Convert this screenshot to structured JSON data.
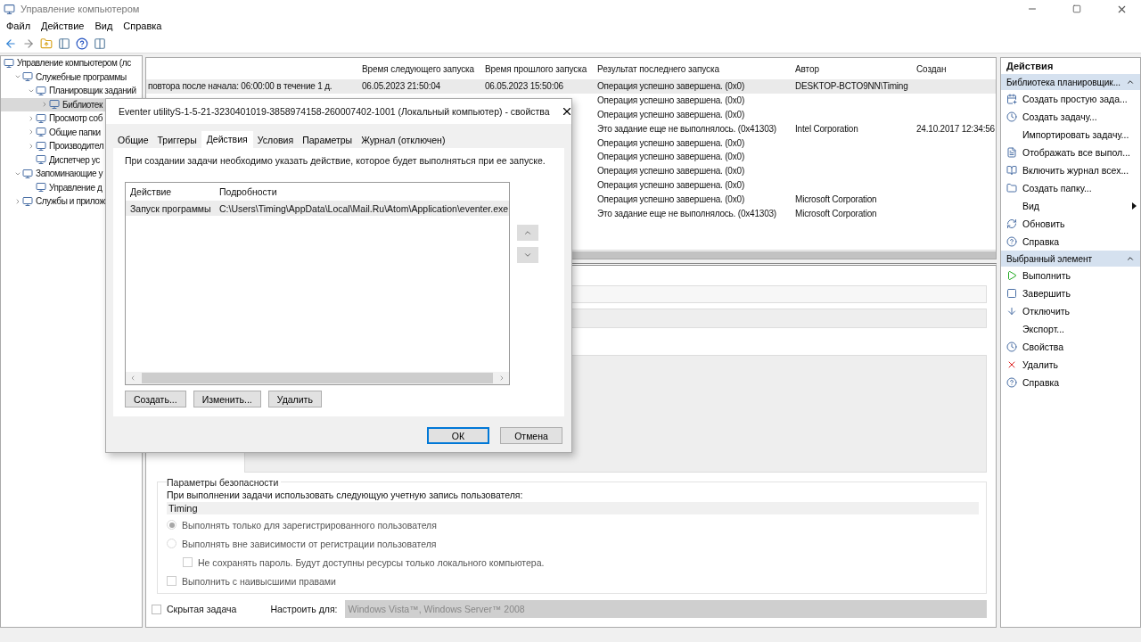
{
  "window": {
    "title": "Управление компьютером"
  },
  "menu": [
    "Файл",
    "Действие",
    "Вид",
    "Справка"
  ],
  "tree": [
    {
      "label": "Управление компьютером (лс",
      "selected": false,
      "children": [
        {
          "label": "Служебные программы",
          "expanded": true,
          "selected": false,
          "children": [
            {
              "label": "Планировщик заданий",
              "expanded": true,
              "selected": false,
              "children": [
                {
                  "label": "Библиотек",
                  "expanded": false,
                  "selected": true
                }
              ]
            },
            {
              "label": "Просмотр соб",
              "expanded": false,
              "selected": false
            },
            {
              "label": "Общие папки",
              "expanded": false,
              "selected": false
            },
            {
              "label": "Производител",
              "expanded": false,
              "selected": false
            },
            {
              "label": "Диспетчер ус",
              "selected": false
            }
          ]
        },
        {
          "label": "Запоминающие у",
          "expanded": true,
          "selected": false,
          "children": [
            {
              "label": "Управление д",
              "selected": false
            }
          ]
        },
        {
          "label": "Службы и прилож",
          "expanded": false,
          "selected": false
        }
      ]
    }
  ],
  "table": {
    "columns": [
      "",
      "Время следующего запуска",
      "Время прошлого запуска",
      "Результат последнего запуска",
      "Автор",
      "Создан"
    ],
    "rows": [
      {
        "selected": true,
        "cells": [
          "повтора после начала: 06:00:00 в течение 1 д.",
          "06.05.2023 21:50:04",
          "06.05.2023 15:50:06",
          "Операция успешно завершена. (0x0)",
          "DESKTOP-BCTO9NN\\Timing",
          ""
        ]
      },
      {
        "selected": false,
        "cells": [
          "",
          "",
          "",
          "Операция успешно завершена. (0x0)",
          "",
          ""
        ]
      },
      {
        "selected": false,
        "cells": [
          "",
          "",
          "",
          "Операция успешно завершена. (0x0)",
          "",
          ""
        ]
      },
      {
        "selected": false,
        "cells": [
          "",
          "",
          "",
          "Это задание еще не выполнялось. (0x41303)",
          "Intel Corporation",
          "24.10.2017 12:34:56"
        ]
      },
      {
        "selected": false,
        "cells": [
          "",
          "",
          "",
          "Операция успешно завершена. (0x0)",
          "",
          ""
        ]
      },
      {
        "selected": false,
        "cells": [
          "",
          "",
          "",
          "Операция успешно завершена. (0x0)",
          "",
          ""
        ]
      },
      {
        "selected": false,
        "cells": [
          "",
          "",
          "",
          "Операция успешно завершена. (0x0)",
          "",
          ""
        ]
      },
      {
        "selected": false,
        "cells": [
          "",
          "",
          "",
          "Операция успешно завершена. (0x0)",
          "",
          ""
        ]
      },
      {
        "selected": false,
        "cells": [
          "",
          "",
          "",
          "Операция успешно завершена. (0x0)",
          "Microsoft Corporation",
          ""
        ]
      },
      {
        "selected": false,
        "cells": [
          "",
          "",
          "",
          "Это задание еще не выполнялось. (0x41303)",
          "Microsoft Corporation",
          ""
        ]
      }
    ]
  },
  "security": {
    "title": "Параметры безопасности",
    "account_label": "При выполнении задачи использовать следующую учетную запись пользователя:",
    "account": "Timing",
    "options": [
      {
        "kind": "radio",
        "label": "Выполнять только для зарегистрированного пользователя",
        "selected": true,
        "disabled": true
      },
      {
        "kind": "radio",
        "label": "Выполнять вне зависимости от регистрации пользователя",
        "selected": false,
        "disabled": true
      },
      {
        "kind": "subcheck",
        "label": "Не сохранять пароль. Будут доступны ресурсы только локального компьютера.",
        "checked": false,
        "disabled": true
      },
      {
        "kind": "check",
        "label": "Выполнить с наивысшими правами",
        "checked": false,
        "disabled": true
      }
    ],
    "hidden": {
      "label": "Скрытая задача",
      "checked": false
    },
    "configure": {
      "label": "Настроить для:",
      "value": "Windows Vista™, Windows Server™ 2008"
    }
  },
  "actions": {
    "title": "Действия",
    "sections": [
      {
        "title": "Библиотека планировщик...",
        "expanded": true,
        "items": [
          {
            "label": "Создать простую зада..."
          },
          {
            "label": "Создать задачу..."
          },
          {
            "label": "Импортировать задачу..."
          },
          {
            "label": "Отображать все выпол..."
          },
          {
            "label": "Включить журнал всех..."
          },
          {
            "label": "Создать папку..."
          },
          {
            "label": "Вид",
            "kind": "submenu"
          },
          {
            "label": "Обновить"
          },
          {
            "label": "Справка"
          }
        ]
      },
      {
        "title": "Выбранный элемент",
        "expanded": true,
        "items": [
          {
            "label": "Выполнить"
          },
          {
            "label": "Завершить"
          },
          {
            "label": "Отключить"
          },
          {
            "label": "Экспорт..."
          },
          {
            "label": "Свойства"
          },
          {
            "label": "Удалить"
          },
          {
            "label": "Справка"
          }
        ]
      }
    ]
  },
  "dialog": {
    "title": "Eventer utilityS-1-5-21-3230401019-3858974158-260007402-1001 (Локальный компьютер) - свойства",
    "tabs": [
      {
        "label": "Общие",
        "selected": false
      },
      {
        "label": "Триггеры",
        "selected": false
      },
      {
        "label": "Действия",
        "selected": true
      },
      {
        "label": "Условия",
        "selected": false
      },
      {
        "label": "Параметры",
        "selected": false
      },
      {
        "label": "Журнал (отключен)",
        "selected": false
      }
    ],
    "description": "При создании задачи необходимо указать действие, которое будет выполняться при ее запуске.",
    "columns": [
      "Действие",
      "Подробности"
    ],
    "rows": [
      {
        "selected": true,
        "cells": [
          "Запуск программы",
          "C:\\Users\\Timing\\AppData\\Local\\Mail.Ru\\Atom\\Application\\eventer.exe"
        ]
      }
    ],
    "buttons": [
      "Создать...",
      "Изменить...",
      "Удалить"
    ],
    "footer": [
      {
        "label": "ОК",
        "default": true
      },
      {
        "label": "Отмена",
        "default": false
      }
    ]
  }
}
